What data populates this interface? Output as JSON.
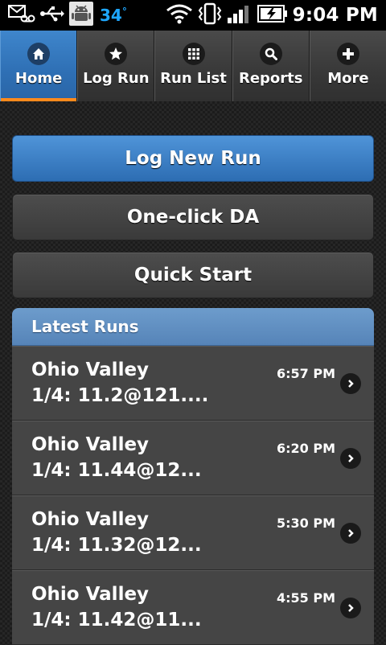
{
  "status_bar": {
    "temperature": "34",
    "degree": "°",
    "time": "9:04 PM"
  },
  "tabs": [
    {
      "label": "Home",
      "icon": "home-icon",
      "active": true
    },
    {
      "label": "Log Run",
      "icon": "star-icon",
      "active": false
    },
    {
      "label": "Run List",
      "icon": "grid-icon",
      "active": false
    },
    {
      "label": "Reports",
      "icon": "search-icon",
      "active": false
    },
    {
      "label": "More",
      "icon": "plus-icon",
      "active": false
    }
  ],
  "buttons": {
    "log_new_run": "Log New Run",
    "one_click_da": "One-click DA",
    "quick_start": "Quick Start"
  },
  "latest_runs": {
    "header": "Latest Runs",
    "items": [
      {
        "title": "Ohio Valley",
        "detail": "1/4: 11.2@121....",
        "time": "6:57 PM"
      },
      {
        "title": "Ohio Valley",
        "detail": "1/4: 11.44@12...",
        "time": "6:20 PM"
      },
      {
        "title": "Ohio Valley",
        "detail": "1/4: 11.32@12...",
        "time": "5:30 PM"
      },
      {
        "title": "Ohio Valley",
        "detail": "1/4: 11.42@11...",
        "time": "4:55 PM"
      }
    ]
  },
  "colors": {
    "accent_blue": "#2e6fb4",
    "active_tab_indicator": "#ff8a1c",
    "temperature_blue": "#1ea7ff",
    "list_header_blue": "#5f8fc2"
  }
}
